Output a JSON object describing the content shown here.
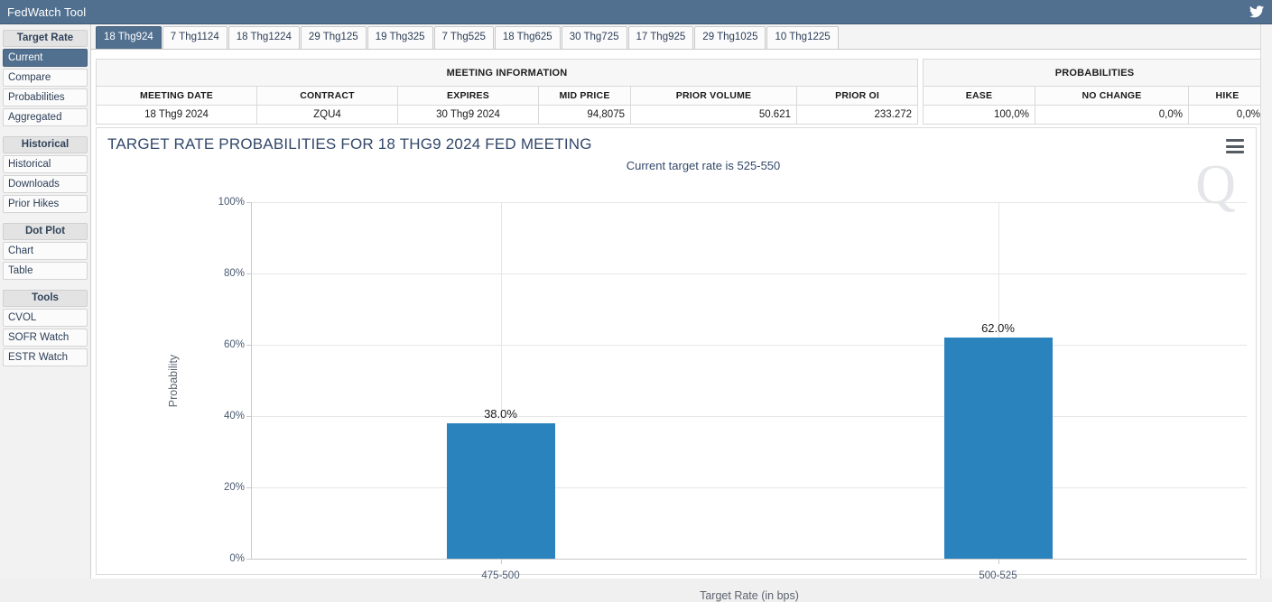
{
  "window": {
    "title": "FedWatch Tool",
    "twitter_icon": "twitter-icon"
  },
  "sidebar": {
    "groups": [
      {
        "header": "Target Rate",
        "items": [
          {
            "label": "Current",
            "active": true
          },
          {
            "label": "Compare",
            "active": false
          },
          {
            "label": "Probabilities",
            "active": false
          },
          {
            "label": "Aggregated",
            "active": false
          }
        ]
      },
      {
        "header": "Historical",
        "items": [
          {
            "label": "Historical",
            "active": false
          },
          {
            "label": "Downloads",
            "active": false
          },
          {
            "label": "Prior Hikes",
            "active": false
          }
        ]
      },
      {
        "header": "Dot Plot",
        "items": [
          {
            "label": "Chart",
            "active": false
          },
          {
            "label": "Table",
            "active": false
          }
        ]
      },
      {
        "header": "Tools",
        "items": [
          {
            "label": "CVOL",
            "active": false
          },
          {
            "label": "SOFR Watch",
            "active": false
          },
          {
            "label": "ESTR Watch",
            "active": false
          }
        ]
      }
    ]
  },
  "tabs": [
    {
      "label": "18 Thg924",
      "active": true
    },
    {
      "label": "7 Thg1124",
      "active": false
    },
    {
      "label": "18 Thg1224",
      "active": false
    },
    {
      "label": "29 Thg125",
      "active": false
    },
    {
      "label": "19 Thg325",
      "active": false
    },
    {
      "label": "7 Thg525",
      "active": false
    },
    {
      "label": "18 Thg625",
      "active": false
    },
    {
      "label": "30 Thg725",
      "active": false
    },
    {
      "label": "17 Thg925",
      "active": false
    },
    {
      "label": "29 Thg1025",
      "active": false
    },
    {
      "label": "10 Thg1225",
      "active": false
    }
  ],
  "meeting_information": {
    "group_header": "MEETING INFORMATION",
    "columns": [
      "MEETING DATE",
      "CONTRACT",
      "EXPIRES",
      "MID PRICE",
      "PRIOR VOLUME",
      "PRIOR OI"
    ],
    "row": [
      "18 Thg9 2024",
      "ZQU4",
      "30 Thg9 2024",
      "94,8075",
      "50.621",
      "233.272"
    ]
  },
  "probabilities": {
    "group_header": "PROBABILITIES",
    "columns": [
      "EASE",
      "NO CHANGE",
      "HIKE"
    ],
    "row": [
      "100,0%",
      "0,0%",
      "0,0%"
    ]
  },
  "chart_data": {
    "type": "bar",
    "title": "TARGET RATE PROBABILITIES FOR 18 THG9 2024 FED MEETING",
    "subtitle": "Current target rate is 525-550",
    "categories": [
      "475-500",
      "500-525"
    ],
    "values": [
      38.0,
      62.0
    ],
    "data_labels": [
      "38.0%",
      "62.0%"
    ],
    "xlabel": "Target Rate (in bps)",
    "ylabel": "Probability",
    "ylim": [
      0,
      100
    ],
    "yticks": [
      0,
      20,
      40,
      60,
      80,
      100
    ],
    "ytick_labels": [
      "0%",
      "20%",
      "40%",
      "60%",
      "80%",
      "100%"
    ],
    "grid": true,
    "legend": "none",
    "bar_color": "#2b83bd",
    "watermark": "Q",
    "menu_icon": "hamburger-menu-icon"
  }
}
